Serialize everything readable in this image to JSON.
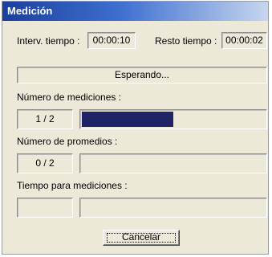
{
  "window": {
    "title": "Medición"
  },
  "interval": {
    "label": "Interv. tiempo :",
    "value": "00:00:10"
  },
  "remaining": {
    "label": "Resto tiempo :",
    "value": "00:00:02"
  },
  "status": {
    "text": "Esperando..."
  },
  "measurements": {
    "label": "Número de mediciones :",
    "count": "1 / 2",
    "progress": 0.5
  },
  "averages": {
    "label": "Número de promedios :",
    "count": "0 / 2",
    "progress": 0.0
  },
  "measurement_time": {
    "label": "Tiempo para mediciones :",
    "value": "",
    "progress": 0.0
  },
  "buttons": {
    "cancel": "Cancelar"
  },
  "colors": {
    "titlebar": "#1b3f9c",
    "progress_fill": "#1f2466",
    "dialog_bg": "#ece9d8"
  }
}
